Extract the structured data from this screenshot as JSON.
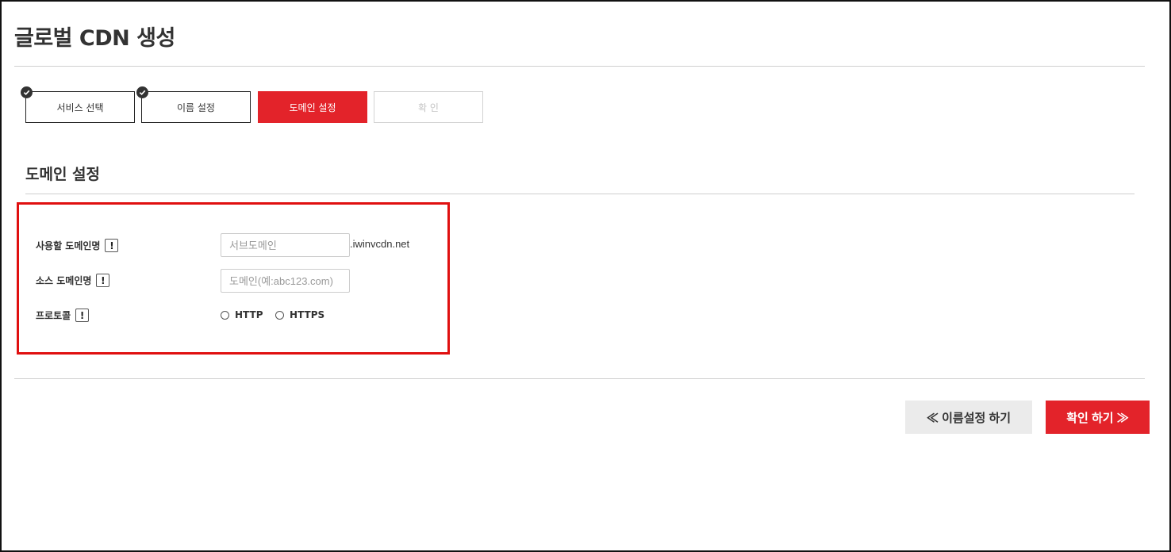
{
  "page": {
    "title": "글로벌 CDN 생성"
  },
  "steps": [
    {
      "label": "서비스 선택",
      "state": "done"
    },
    {
      "label": "이름 설정",
      "state": "done"
    },
    {
      "label": "도메인 설정",
      "state": "active"
    },
    {
      "label": "확 인",
      "state": "disabled"
    }
  ],
  "section": {
    "title": "도메인 설정"
  },
  "form": {
    "domain_name": {
      "label": "사용할 도메인명",
      "placeholder": "서브도메인",
      "value": "",
      "suffix": ".iwinvcdn.net"
    },
    "source_domain": {
      "label": "소스 도메인명",
      "placeholder": "도메인(예:abc123.com)",
      "value": ""
    },
    "protocol": {
      "label": "프로토콜",
      "options": [
        "HTTP",
        "HTTPS"
      ],
      "selected": null
    },
    "info_icon_glyph": "!"
  },
  "buttons": {
    "prev": "≪ 이름설정 하기",
    "next": "확인 하기 ≫"
  },
  "colors": {
    "accent": "#e3232a",
    "highlight_box": "#e01010",
    "check_badge": "#333333"
  },
  "icons": {
    "step_done": "check-circle-icon",
    "field_help": "info-icon"
  }
}
